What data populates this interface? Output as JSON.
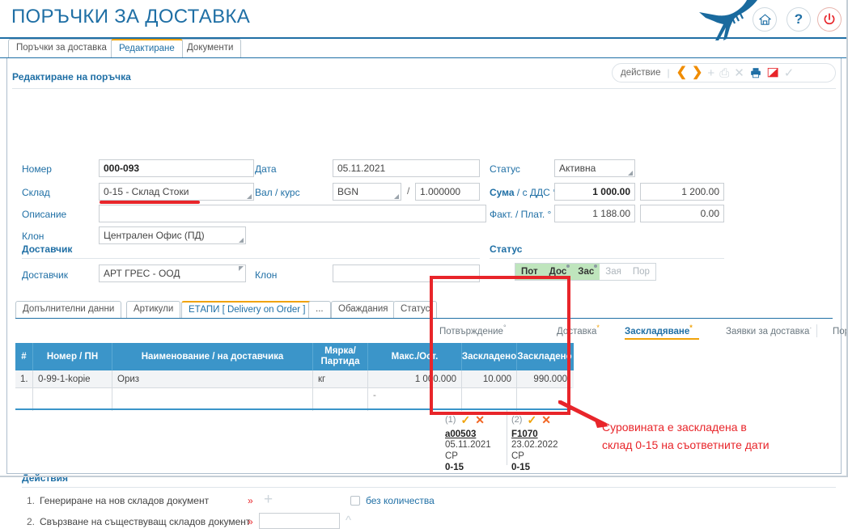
{
  "header": {
    "title": "ПОРЪЧКИ ЗА ДОСТАВКА",
    "home_icon": "home-icon",
    "help_icon": "?",
    "power_icon": "power-icon",
    "brand_icon": "bird-logo",
    "accent_blue": "#1f6fa5",
    "accent_orange": "#f0a30a",
    "accent_red": "#e8252a"
  },
  "tabs": [
    {
      "label": "Поръчки за доставка",
      "active": false
    },
    {
      "label": "Редактиране",
      "active": true
    },
    {
      "label": "Документи",
      "active": false
    }
  ],
  "panel": {
    "section_title": "Редактиране на поръчка",
    "toolbar": {
      "action_label": "действие",
      "prev_icon": "chevron-left-icon",
      "next_icon": "chevron-right-icon",
      "add_icon": "plus-icon",
      "copy_icon": "copy-icon",
      "delete_icon": "close-icon",
      "print_icon": "printer-icon",
      "export_icon": "export-icon",
      "confirm_icon": "check-icon"
    }
  },
  "form": {
    "nomer": {
      "label": "Номер",
      "value": "000-093"
    },
    "sklad": {
      "label": "Склад",
      "value": "0-15 - Склад Стоки"
    },
    "opisanie": {
      "label": "Описание",
      "value": ""
    },
    "klon": {
      "label": "Клон",
      "value": "Централен Офис (ПД)"
    },
    "data": {
      "label": "Дата",
      "value": "05.11.2021"
    },
    "val": {
      "label": "Вал / курс",
      "value": "BGN",
      "separator": "/",
      "rate": "1.000000"
    },
    "status": {
      "label": "Статус",
      "value": "Активна"
    },
    "suma": {
      "label_bold": "Сума",
      "label_rest": " / с ДДС °",
      "value": "1 000.00",
      "value2": "1 200.00"
    },
    "fakt": {
      "label": "Факт. / Плат. °",
      "value": "1 188.00",
      "value2": "0.00"
    },
    "dostavchik_header": "Доставчик",
    "dostavchik": {
      "label": "Доставчик",
      "value": "АРТ ГРЕС - ООД"
    },
    "klon2": {
      "label": "Клон",
      "value": ""
    },
    "status_header": "Статус",
    "status_pills": [
      {
        "label": "Пот",
        "on": true,
        "dot": false
      },
      {
        "label": "Дос",
        "on": true,
        "dot": true
      },
      {
        "label": "Зас",
        "on": true,
        "dot": true
      },
      {
        "label": "Зая",
        "on": false,
        "dot": false
      },
      {
        "label": "Пор",
        "on": false,
        "dot": false
      }
    ]
  },
  "subtabs": [
    {
      "label": "Допълнителни данни",
      "active": false
    },
    {
      "label": "Артикули",
      "active": false
    },
    {
      "label": "ЕТАПИ [ Delivery on Order ]",
      "active": true
    },
    {
      "label": "...",
      "active": false
    },
    {
      "label": "Обаждания",
      "active": false
    },
    {
      "label": "Статус",
      "active": false
    }
  ],
  "linktabs": [
    {
      "label": "Потвърждение",
      "sup": "°",
      "active": false
    },
    {
      "label": "Доставка",
      "sup": "*",
      "active": false
    },
    {
      "label": "Заскладяване",
      "sup": "*",
      "active": true
    },
    {
      "label": "Заявки за доставка",
      "sup": "·",
      "active": false
    },
    {
      "label": "Поръчки на клиенти",
      "sup": "·",
      "active": false
    }
  ],
  "grid": {
    "columns": [
      "#",
      "Номер / ПН",
      "Наименование / на доставчика",
      "Мярка/Партида",
      "Макс./Ост.",
      "Заскладено",
      "Заскладено"
    ],
    "column_mqrka_line1": "Мярка/",
    "column_mqrka_line2": "Партида",
    "rows": [
      {
        "idx": "1.",
        "nomer": "0-99-1-kopie",
        "name": "Ориз",
        "mqrka": "кг",
        "maks": "1 000.000",
        "zaskladeno1": "10.000",
        "zaskladeno2": "990.000"
      }
    ],
    "subrow": {
      "idx": "",
      "nomer": "",
      "name": "",
      "mqrka": "",
      "maks": "-",
      "zaskladeno1": "",
      "zaskladeno2": ""
    }
  },
  "documents": [
    {
      "index": "(1)",
      "ok_icon": "check-icon",
      "remove_icon": "close-icon",
      "link": "a00503",
      "date": "05.11.2021 СР",
      "warehouse": "0-15"
    },
    {
      "index": "(2)",
      "ok_icon": "check-icon",
      "remove_icon": "close-icon",
      "link": "F1070",
      "date": "23.02.2022 СР",
      "warehouse": "0-15"
    }
  ],
  "annotation": {
    "line1": "Суровината е заскладена в",
    "line2": "склад 0-15 на съответните дати"
  },
  "actions": {
    "header": "Действия",
    "items": [
      {
        "num": "1.",
        "text": "Генериране на нов складов документ",
        "chevron": "»",
        "icon": "plus-icon",
        "checkbox_label": "без количества"
      },
      {
        "num": "2.",
        "text": "Свързване на съществуващ складов документ",
        "chevron": "»",
        "input_value": "",
        "icon": "chevron-up-icon"
      }
    ]
  }
}
